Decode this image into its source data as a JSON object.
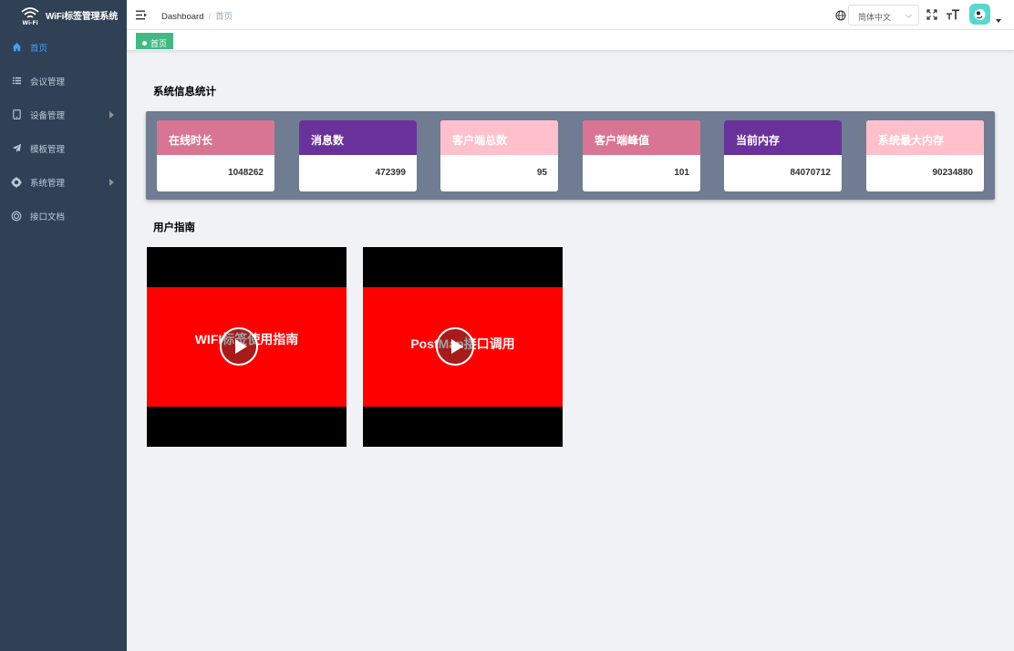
{
  "app": {
    "title": "WiFi标签管理系统"
  },
  "sidebar": {
    "items": [
      {
        "label": "首页",
        "icon": "home-icon",
        "active": true
      },
      {
        "label": "会议管理",
        "icon": "list-icon"
      },
      {
        "label": "设备管理",
        "icon": "device-icon",
        "expandable": true
      },
      {
        "label": "模板管理",
        "icon": "send-icon"
      },
      {
        "label": "系统管理",
        "icon": "gear-icon",
        "expandable": true
      },
      {
        "label": "接口文档",
        "icon": "api-icon"
      }
    ]
  },
  "navbar": {
    "breadcrumb": [
      "Dashboard",
      "首页"
    ],
    "language": "简体中文"
  },
  "tags": {
    "active": "首页"
  },
  "stats": {
    "title": "系统信息统计",
    "cards": [
      {
        "label": "在线时长",
        "value": "1048262",
        "color": "#d87592"
      },
      {
        "label": "消息数",
        "value": "472399",
        "color": "#69329a"
      },
      {
        "label": "客户端总数",
        "value": "95",
        "color": "#ffc0cb"
      },
      {
        "label": "客户端峰值",
        "value": "101",
        "color": "#d87592"
      },
      {
        "label": "当前内存",
        "value": "84070712",
        "color": "#69329a"
      },
      {
        "label": "系统最大内存",
        "value": "90234880",
        "color": "#ffc0cb"
      }
    ]
  },
  "guide": {
    "title": "用户指南",
    "videos": [
      {
        "label": "WIFI标签使用指南"
      },
      {
        "label": "PostMan接口调用"
      }
    ]
  },
  "colors": {
    "sidebar_bg": "#304156",
    "accent": "#409eff",
    "tag_green": "#42b983"
  }
}
